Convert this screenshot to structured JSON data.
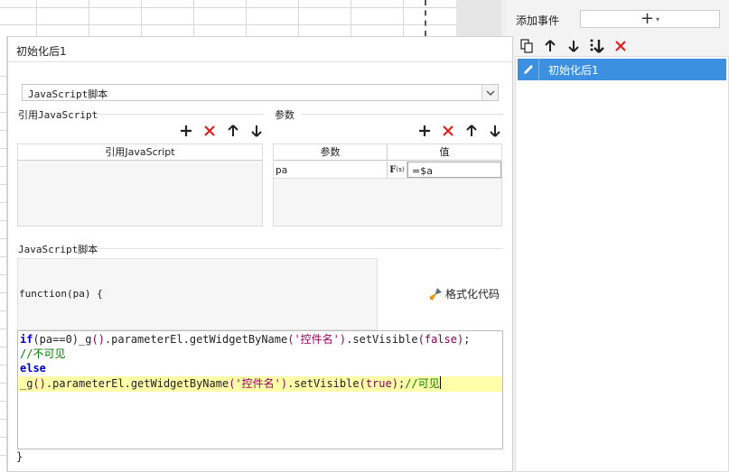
{
  "right_panel": {
    "title": "添加事件",
    "add_plus": "+",
    "add_caret": "▾",
    "toolbar_icons": [
      "copy-icon",
      "arrow-up-icon",
      "arrow-down-icon",
      "sort-down-icon",
      "delete-icon"
    ],
    "events": [
      {
        "label": "初始化后1",
        "icon": "edit-pencil-icon",
        "selected": true
      }
    ]
  },
  "dialog": {
    "title": "初始化后1",
    "script_type": "JavaScript脚本",
    "ref_js": {
      "label": "引用JavaScript",
      "column": "引用JavaScript",
      "rows": []
    },
    "params": {
      "label": "参数",
      "columns": [
        "参数",
        "值"
      ],
      "rows": [
        {
          "name": "pa",
          "fx": "F",
          "fx_sub": "(x)",
          "value": "=$a"
        }
      ]
    },
    "script_section": "JavaScript脚本",
    "function_signature": "function(pa) {",
    "format_button": "格式化代码",
    "code_lines": {
      "l1_if": "if",
      "l1_cond": "(pa==0)",
      "l1_g": "_g",
      "l1_p1": "()",
      "l1_method": ".parameterEl.getWidgetByName",
      "l1_arg": "('控件名')",
      "l1_set": ".setVisible",
      "l1_bool": "(false)",
      "l1_end": ";",
      "l2_comment": "//不可见",
      "l3_else": "else",
      "l4_g": "_g",
      "l4_p1": "()",
      "l4_method": ".parameterEl.getWidgetByName",
      "l4_arg": "('控件名')",
      "l4_set": ".setVisible",
      "l4_bool": "(true)",
      "l4_end": ";",
      "l4_comment": "//可见"
    },
    "closing_brace": "}"
  },
  "colors": {
    "selected_item": "#3d8fe0",
    "delete_red": "#e02020",
    "highlight_line": "#ffffaa",
    "keyword": "#0000c8",
    "comment": "#008000",
    "string": "#9a0066"
  }
}
